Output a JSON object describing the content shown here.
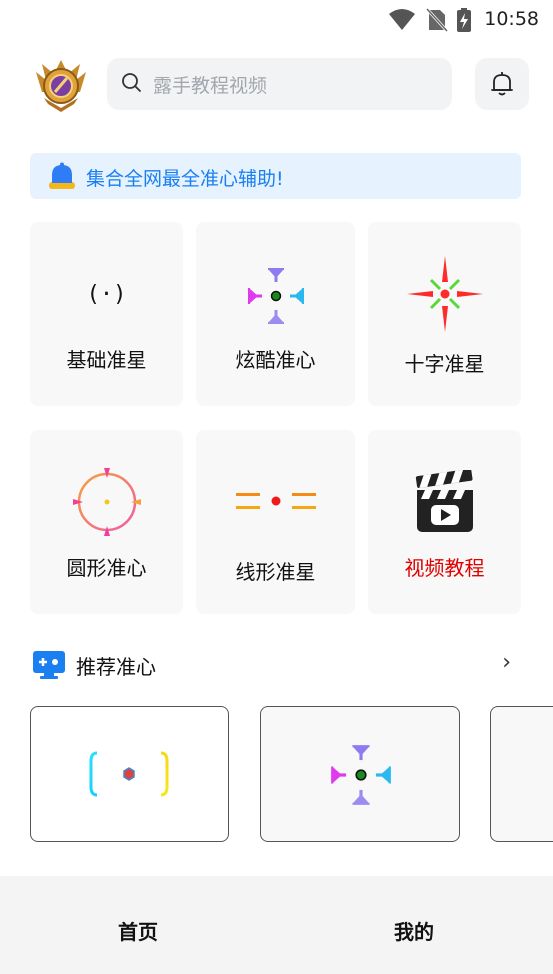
{
  "status_bar": {
    "time": "10:58",
    "icons": [
      "wifi-icon",
      "no-sim-icon",
      "battery-charging-icon"
    ]
  },
  "header": {
    "avatar": "rank-badge-avatar",
    "search_placeholder": "露手教程视频",
    "notification_icon": "bell-icon"
  },
  "notice": {
    "icon": "alert-bell-icon",
    "text": "集合全网最全准心辅助!",
    "color": "#1a7ff0"
  },
  "categories": [
    {
      "label": "基础准星",
      "glyph": "(·)",
      "icon": "basic-crosshair-icon"
    },
    {
      "label": "炫酷准心",
      "icon": "cool-crosshair-icon"
    },
    {
      "label": "十字准星",
      "icon": "cross-crosshair-icon"
    },
    {
      "label": "圆形准心",
      "icon": "circle-crosshair-icon"
    },
    {
      "label": "线形准星",
      "icon": "line-crosshair-icon"
    },
    {
      "label": "视频教程",
      "icon": "video-clapper-icon",
      "color": "#e00000"
    }
  ],
  "recommend": {
    "icon": "recommend-screen-icon",
    "title": "推荐准心",
    "more_icon": "chevron-right-icon",
    "more": "›",
    "items": [
      {
        "icon": "bracket-crosshair-icon"
      },
      {
        "icon": "cool-crosshair-icon"
      },
      {
        "icon": "partial-card"
      }
    ]
  },
  "bottom_nav": {
    "tabs": [
      {
        "label": "首页"
      },
      {
        "label": "我的"
      }
    ]
  }
}
